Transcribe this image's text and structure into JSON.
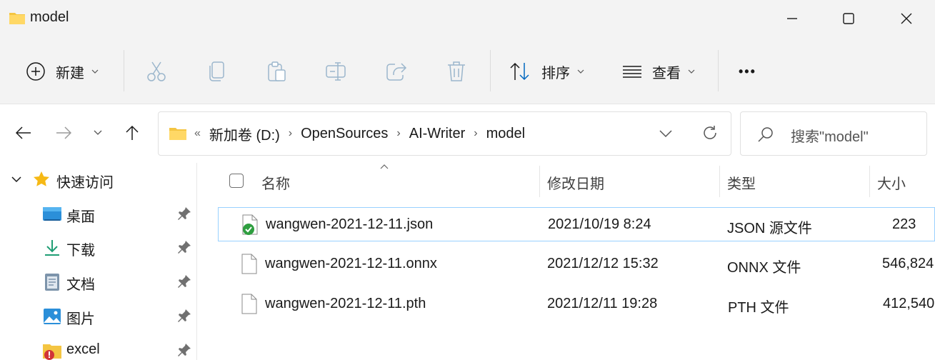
{
  "window": {
    "title": "model"
  },
  "toolbar": {
    "new_label": "新建",
    "sort_label": "排序",
    "view_label": "查看",
    "more_label": "•••"
  },
  "address": {
    "lead": "«",
    "crumbs": [
      "新加卷 (D:)",
      "OpenSources",
      "AI-Writer",
      "model"
    ]
  },
  "search": {
    "placeholder": "搜索\"model\""
  },
  "sidebar": {
    "quick_access": "快速访问",
    "items": [
      {
        "label": "桌面",
        "icon": "desktop-icon"
      },
      {
        "label": "下载",
        "icon": "download-icon"
      },
      {
        "label": "文档",
        "icon": "documents-icon"
      },
      {
        "label": "图片",
        "icon": "pictures-icon"
      },
      {
        "label": "excel",
        "icon": "excel-folder-icon"
      }
    ]
  },
  "columns": {
    "name": "名称",
    "modified": "修改日期",
    "type": "类型",
    "size": "大小"
  },
  "files": [
    {
      "name": "wangwen-2021-12-11.json",
      "modified": "2021/10/19 8:24",
      "type": "JSON 源文件",
      "size": "223",
      "icon": "json-file-icon"
    },
    {
      "name": "wangwen-2021-12-11.onnx",
      "modified": "2021/12/12 15:32",
      "type": "ONNX 文件",
      "size": "546,824",
      "icon": "file-icon"
    },
    {
      "name": "wangwen-2021-12-11.pth",
      "modified": "2021/12/11 19:28",
      "type": "PTH 文件",
      "size": "412,540",
      "icon": "file-icon"
    }
  ],
  "colors": {
    "folder": "#f4c542",
    "selection_border": "#99d1ff",
    "accent": "#0067c0"
  }
}
